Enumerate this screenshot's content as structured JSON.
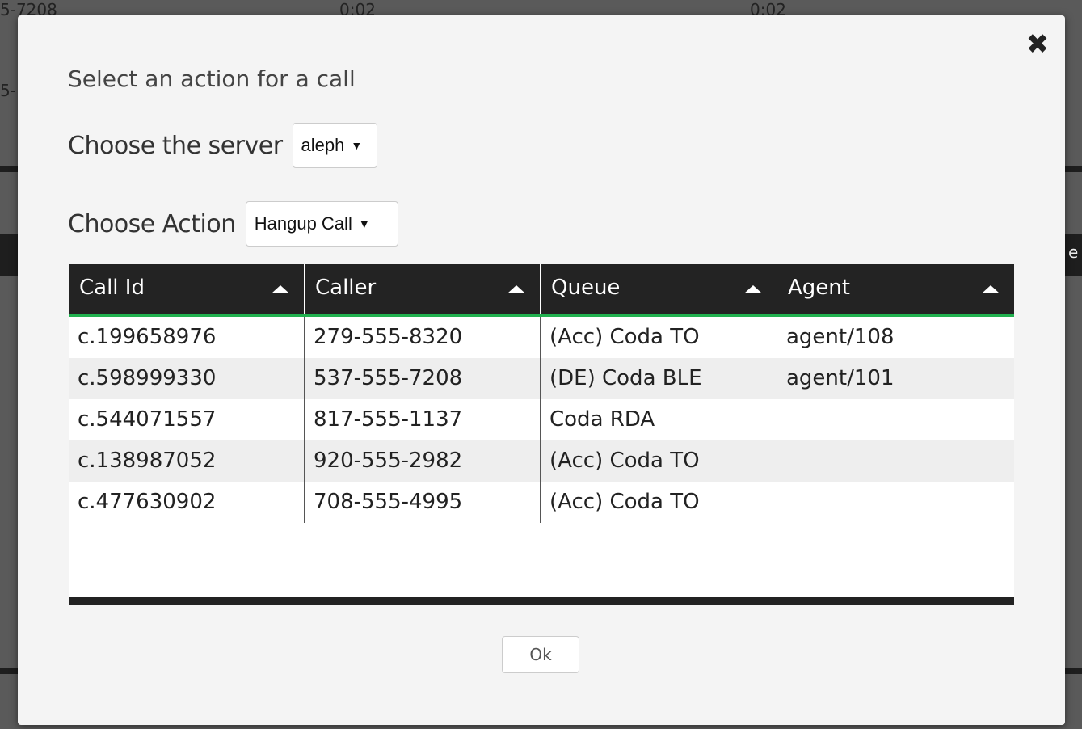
{
  "background": {
    "fragments": [
      "5-7208",
      "0:02",
      "0:02",
      "5-",
      "e"
    ]
  },
  "modal": {
    "close_glyph": "✖",
    "title": "Select an action for a call",
    "server": {
      "label": "Choose the server",
      "value": "aleph"
    },
    "action": {
      "label": "Choose Action",
      "value": "Hangup Call"
    },
    "ok_label": "Ok"
  },
  "table": {
    "columns": [
      "Call Id",
      "Caller",
      "Queue",
      "Agent"
    ],
    "rows": [
      [
        "c.199658976",
        "279-555-8320",
        "(Acc) Coda TO",
        "agent/108"
      ],
      [
        "c.598999330",
        "537-555-7208",
        "(DE) Coda BLE",
        "agent/101"
      ],
      [
        "c.544071557",
        "817-555-1137",
        "Coda RDA",
        ""
      ],
      [
        "c.138987052",
        "920-555-2982",
        "(Acc) Coda TO",
        ""
      ],
      [
        "c.477630902",
        "708-555-4995",
        "(Acc) Coda TO",
        ""
      ]
    ]
  },
  "colors": {
    "header_bg": "#232323",
    "header_underline": "#21b14f",
    "modal_bg": "#f4f4f4"
  }
}
